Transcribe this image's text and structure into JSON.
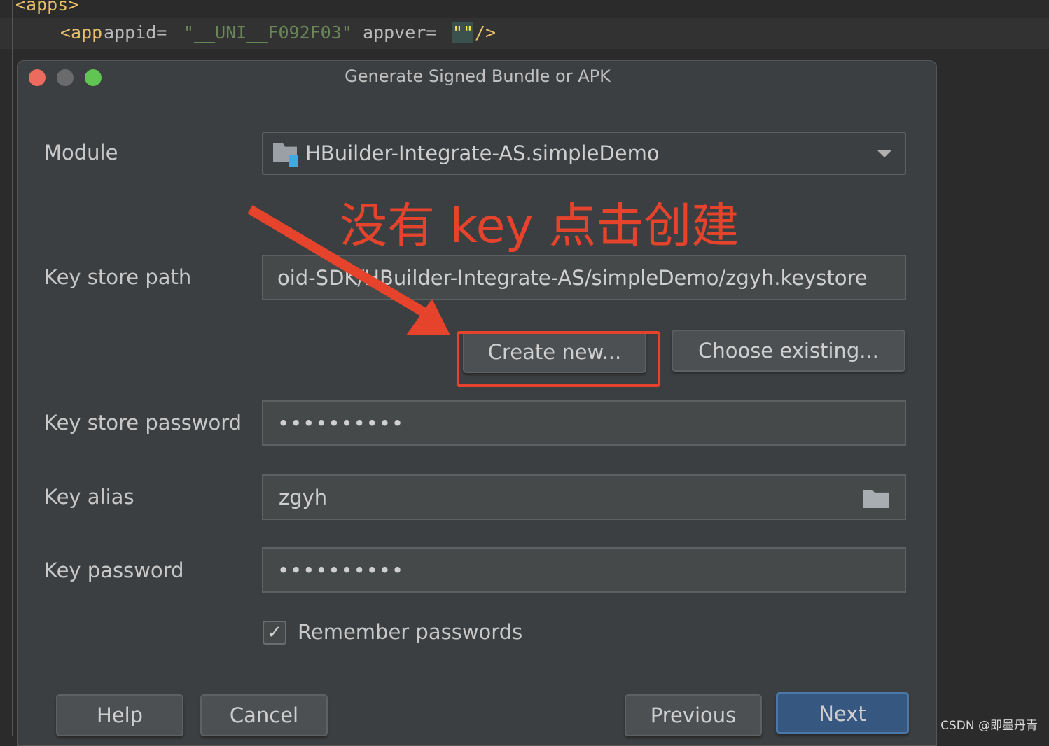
{
  "editor": {
    "line1": "<apps>",
    "tag": "<app",
    "attr1": " appid=",
    "val1": "\"__UNI__F092F03\"",
    "attr2": " appver=",
    "val2": "\"\"",
    "close": "/>"
  },
  "dialog": {
    "title": "Generate Signed Bundle or APK",
    "module": {
      "label": "Module",
      "value": "HBuilder-Integrate-AS.simpleDemo"
    },
    "annotation": "没有 key 点击创建",
    "keystore_path": {
      "label": "Key store path",
      "value": "oid-SDK/HBuilder-Integrate-AS/simpleDemo/zgyh.keystore"
    },
    "create_new": "Create new...",
    "choose_existing": "Choose existing...",
    "keystore_password": {
      "label": "Key store password",
      "value": "••••••••••"
    },
    "key_alias": {
      "label": "Key alias",
      "value": "zgyh"
    },
    "key_password": {
      "label": "Key password",
      "value": "••••••••••"
    },
    "remember": {
      "label": "Remember passwords",
      "checked": true
    },
    "buttons": {
      "help": "Help",
      "cancel": "Cancel",
      "previous": "Previous",
      "next": "Next"
    }
  },
  "watermark": "CSDN @即墨丹青",
  "colors": {
    "accent": "#e5432b",
    "next": "#365880"
  }
}
